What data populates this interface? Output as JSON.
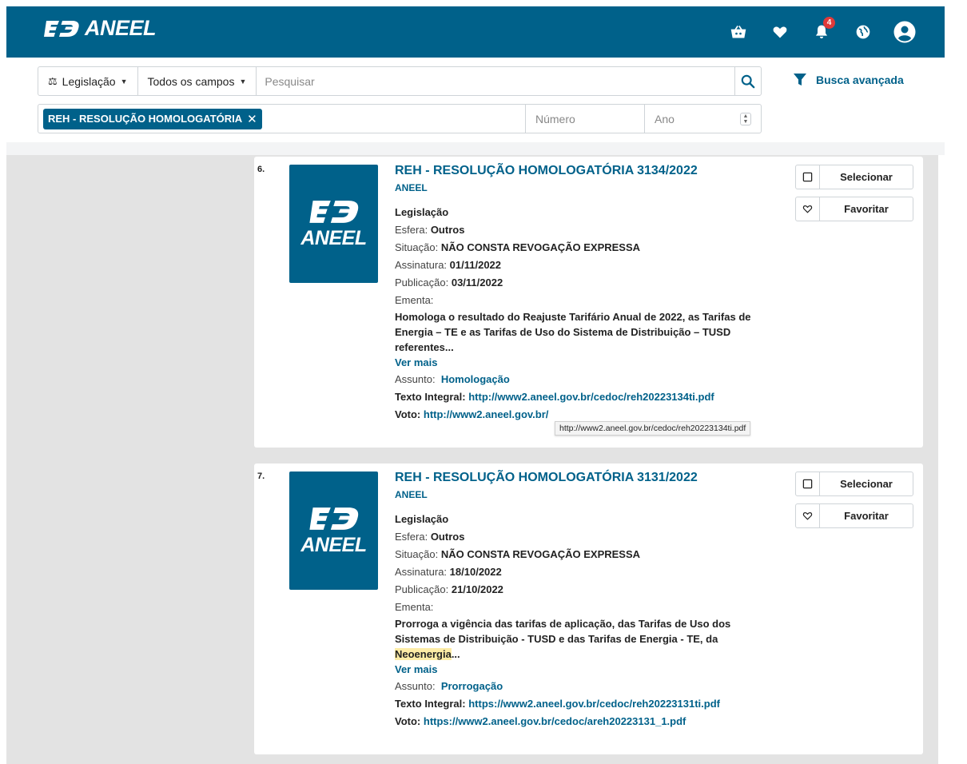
{
  "header": {
    "logo_text": "ANEEL",
    "notification_count": "4",
    "brand_color": "#00618a",
    "icons": [
      "basket-icon",
      "heart-icon",
      "bell-icon",
      "globe-icon",
      "user-avatar-icon"
    ]
  },
  "search": {
    "type_label": "Legislação",
    "field_label": "Todos os campos",
    "placeholder": "Pesquisar",
    "advanced_label": "Busca avançada"
  },
  "filter": {
    "chip_label": "REH - RESOLUÇÃO HOMOLOGATÓRIA",
    "numero_placeholder": "Número",
    "ano_placeholder": "Ano"
  },
  "results": [
    {
      "index": "6.",
      "thumb_text": "ANEEL",
      "title": "REH - RESOLUÇÃO HOMOLOGATÓRIA 3134/2022",
      "org": "ANEEL",
      "category": "Legislação",
      "esfera_label": "Esfera:",
      "esfera": "Outros",
      "situacao_label": "Situação:",
      "situacao": "NÃO CONSTA REVOGAÇÃO EXPRESSA",
      "assinatura_label": "Assinatura:",
      "assinatura": "01/11/2022",
      "publicacao_label": "Publicação:",
      "publicacao": "03/11/2022",
      "ementa_label": "Ementa:",
      "ementa_lines": [
        "Homologa o resultado do Reajuste Tarifário Anual de 2022, as Tarifas de",
        "Energia – TE e as Tarifas de Uso do Sistema de Distribuição – TUSD",
        "referentes..."
      ],
      "ver_mais": "Ver mais",
      "assunto_label": "Assunto:",
      "assunto": "Homologação",
      "texto_label": "Texto Integral:",
      "texto_url": "http://www2.aneel.gov.br/cedoc/reh20223134ti.pdf",
      "voto_label": "Voto:",
      "voto_url_visible": "http://www2.aneel.gov.br/",
      "tooltip": "http://www2.aneel.gov.br/cedoc/reh20223134ti.pdf",
      "select_label": "Selecionar",
      "favorite_label": "Favoritar"
    },
    {
      "index": "7.",
      "thumb_text": "ANEEL",
      "title": "REH - RESOLUÇÃO HOMOLOGATÓRIA 3131/2022",
      "org": "ANEEL",
      "category": "Legislação",
      "esfera_label": "Esfera:",
      "esfera": "Outros",
      "situacao_label": "Situação:",
      "situacao": "NÃO CONSTA REVOGAÇÃO EXPRESSA",
      "assinatura_label": "Assinatura:",
      "assinatura": "18/10/2022",
      "publicacao_label": "Publicação:",
      "publicacao": "21/10/2022",
      "ementa_label": "Ementa:",
      "ementa_lines": [
        "Prorroga a vigência das tarifas de aplicação, das Tarifas de Uso dos",
        "Sistemas de Distribuição - TUSD e das Tarifas de Energia - TE, da"
      ],
      "ementa_highlight": "Neoenergia",
      "ementa_tail": "...",
      "ver_mais": "Ver mais",
      "assunto_label": "Assunto:",
      "assunto": "Prorrogação",
      "texto_label": "Texto Integral:",
      "texto_url": "https://www2.aneel.gov.br/cedoc/reh20223131ti.pdf",
      "voto_label": "Voto:",
      "voto_url": "https://www2.aneel.gov.br/cedoc/areh20223131_1.pdf",
      "select_label": "Selecionar",
      "favorite_label": "Favoritar"
    }
  ]
}
